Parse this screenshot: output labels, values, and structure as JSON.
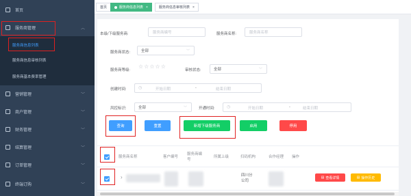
{
  "sidebar": {
    "items": [
      {
        "label": "首页",
        "icon": "home-icon"
      },
      {
        "label": "服务商管理",
        "icon": "service-provider-icon"
      },
      {
        "label": "营销管理",
        "icon": "marketing-icon"
      },
      {
        "label": "商户管理",
        "icon": "merchant-icon"
      },
      {
        "label": "财务管理",
        "icon": "finance-icon"
      },
      {
        "label": "结算管理",
        "icon": "settlement-icon"
      },
      {
        "label": "订单管理",
        "icon": "order-icon"
      },
      {
        "label": "终端订购",
        "icon": "terminal-icon"
      }
    ],
    "submenu": [
      {
        "label": "服务商信息列表",
        "active": true
      },
      {
        "label": "服务商信息审核列表",
        "active": false
      },
      {
        "label": "服务商基本费率管理",
        "active": false
      }
    ]
  },
  "tabs": [
    {
      "label": "首页"
    },
    {
      "label": "服务商信息列表",
      "active": true
    },
    {
      "label": "服务商信息审核列表"
    }
  ],
  "filters": {
    "provider_id_label": "本级/下级服务商:",
    "provider_id_placeholder": "服务商编号",
    "provider_name_label": "服务商名称:",
    "provider_name_placeholder": "服务商名称",
    "status_label": "服务商状态:",
    "status_value": "全部",
    "level_label": "服务商等级:",
    "stars": "☆☆☆☆☆",
    "audit_label": "审核状态:",
    "audit_value": "全部",
    "created_label": "创建时间:",
    "start_placeholder": "开始日期",
    "range_sep": "-",
    "end_placeholder": "结束日期",
    "risk_label": "风控标识:",
    "risk_value": "全部",
    "open_label": "开通时间:"
  },
  "buttons": {
    "query": "查询",
    "reset": "重置",
    "add_sub": "新增下级服务商",
    "enable": "启用",
    "disable": "停用",
    "detail": "查看详情",
    "history": "操作历史"
  },
  "table": {
    "headers": [
      "服务商名称",
      "客户编号",
      "服务商编号",
      "所属上级",
      "扫码机构",
      "合作经理",
      "操作"
    ],
    "row": {
      "org": "四川分公司"
    }
  },
  "colors": {
    "accent": "#409eff",
    "sidebar": "#304156",
    "green": "#13ce66",
    "red": "#ff4949",
    "yellow": "#ffba00",
    "annotation": "#e02020"
  }
}
